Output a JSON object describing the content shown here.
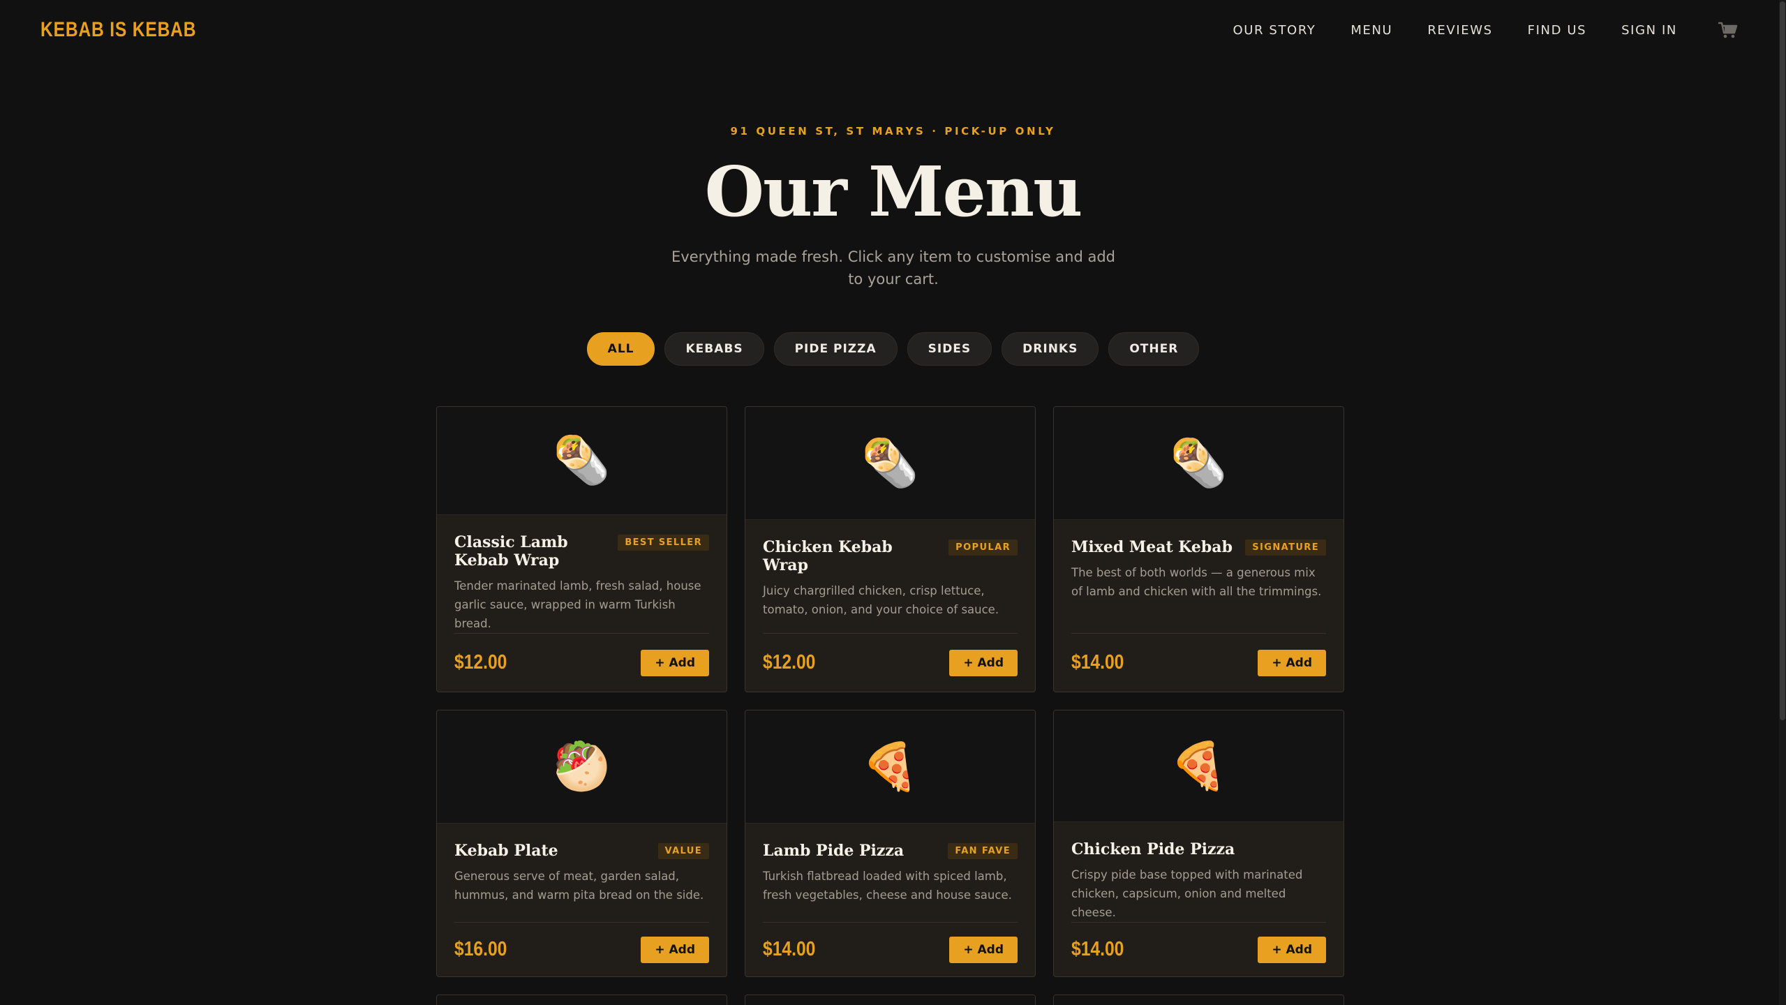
{
  "brand": {
    "logo": "KEBAB IS KEBAB",
    "accent": "#e8a020",
    "background": "#111111"
  },
  "nav": {
    "links": [
      "OUR STORY",
      "MENU",
      "REVIEWS",
      "FIND US",
      "SIGN IN"
    ],
    "cart_icon": "cart-icon"
  },
  "hero": {
    "eyebrow": "91 QUEEN ST, ST MARYS · PICK-UP ONLY",
    "title": "Our Menu",
    "subtitle": "Everything made fresh. Click any item to customise and add to your cart."
  },
  "filters": {
    "items": [
      "ALL",
      "KEBABS",
      "PIDE PIZZA",
      "SIDES",
      "DRINKS",
      "OTHER"
    ],
    "active": "ALL"
  },
  "menu": {
    "add_label": "+ Add",
    "items": [
      {
        "emoji": "🌯",
        "icon": "burrito-icon",
        "name": "Classic Lamb Kebab Wrap",
        "badge": "BEST SELLER",
        "desc": "Tender marinated lamb, fresh salad, house garlic sauce, wrapped in warm Turkish bread.",
        "price": "$12.00"
      },
      {
        "emoji": "🌯",
        "icon": "burrito-icon",
        "name": "Chicken Kebab Wrap",
        "badge": "POPULAR",
        "desc": "Juicy chargrilled chicken, crisp lettuce, tomato, onion, and your choice of sauce.",
        "price": "$12.00"
      },
      {
        "emoji": "🌯",
        "icon": "burrito-icon",
        "name": "Mixed Meat Kebab",
        "badge": "SIGNATURE",
        "desc": "The best of both worlds — a generous mix of lamb and chicken with all the trimmings.",
        "price": "$14.00"
      },
      {
        "emoji": "🥙",
        "icon": "stuffed-flatbread-icon",
        "name": "Kebab Plate",
        "badge": "VALUE",
        "desc": "Generous serve of meat, garden salad, hummus, and warm pita bread on the side.",
        "price": "$16.00"
      },
      {
        "emoji": "🍕",
        "icon": "pizza-icon",
        "name": "Lamb Pide Pizza",
        "badge": "FAN FAVE",
        "desc": "Turkish flatbread loaded with spiced lamb, fresh vegetables, cheese and house sauce.",
        "price": "$14.00"
      },
      {
        "emoji": "🍕",
        "icon": "pizza-icon",
        "name": "Chicken Pide Pizza",
        "badge": "",
        "desc": "Crispy pide base topped with marinated chicken, capsicum, onion and melted cheese.",
        "price": "$14.00"
      }
    ]
  }
}
